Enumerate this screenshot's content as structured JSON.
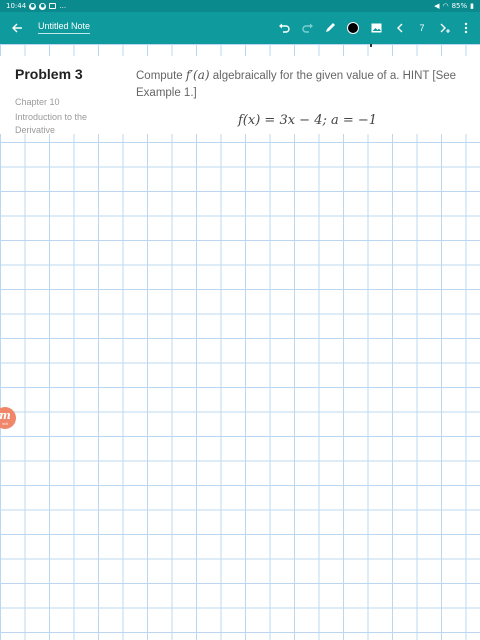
{
  "status_bar": {
    "time": "10:44",
    "dots": "…",
    "battery": "85%"
  },
  "toolbar": {
    "back_icon": "arrow-left-icon",
    "note_title": "Untitled Note",
    "undo_icon": "undo-icon",
    "redo_icon": "redo-icon",
    "pen_icon": "pen-icon",
    "color": "#000000",
    "image_icon": "image-icon",
    "prev_icon": "chevron-left-icon",
    "page_number": "7",
    "next_icon": "next-page-icon",
    "menu_icon": "more-vertical-icon"
  },
  "problem": {
    "title": "Problem 3",
    "chapter_number": "Chapter 10",
    "chapter_name": "Introduction to the Derivative",
    "prompt_before": "Compute ",
    "prompt_math": "f′(a)",
    "prompt_after": " algebraically for the given value of a. HINT [See Example 1.]",
    "equation": "f(x) = 3x − 4; a = −1"
  },
  "floating_badge": {
    "letter": "m",
    "sub": "edi"
  },
  "colors": {
    "status_bar": "#0a8a8c",
    "toolbar": "#0f9b9d",
    "grid_line": "#bcd8f0",
    "badge": "#f0876a"
  }
}
